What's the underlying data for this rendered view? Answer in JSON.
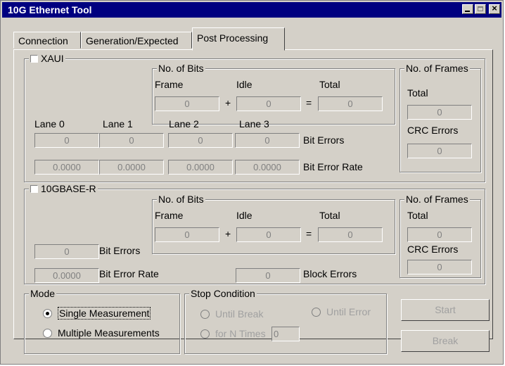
{
  "window": {
    "title": "10G Ethernet Tool"
  },
  "tabs": [
    {
      "label": "Connection"
    },
    {
      "label": "Generation/Expected"
    },
    {
      "label": "Post Processing"
    }
  ],
  "xaui": {
    "label": "XAUI",
    "checked": false,
    "bits_group": {
      "title": "No. of Bits",
      "frame_label": "Frame",
      "idle_label": "Idle",
      "total_label": "Total",
      "frame": "0",
      "idle": "0",
      "total": "0",
      "plus": "+",
      "equals": "="
    },
    "frames_group": {
      "title": "No. of Frames",
      "total_label": "Total",
      "total": "0",
      "crc_label": "CRC Errors",
      "crc": "0"
    },
    "lanes": [
      {
        "label": "Lane 0",
        "bit_errors": "0",
        "bit_error_rate": "0.0000"
      },
      {
        "label": "Lane 1",
        "bit_errors": "0",
        "bit_error_rate": "0.0000"
      },
      {
        "label": "Lane 2",
        "bit_errors": "0",
        "bit_error_rate": "0.0000"
      },
      {
        "label": "Lane 3",
        "bit_errors": "0",
        "bit_error_rate": "0.0000"
      }
    ],
    "bit_errors_label": "Bit Errors",
    "bit_error_rate_label": "Bit Error Rate"
  },
  "base_r": {
    "label": "10GBASE-R",
    "checked": false,
    "bits_group": {
      "title": "No. of Bits",
      "frame_label": "Frame",
      "idle_label": "Idle",
      "total_label": "Total",
      "frame": "0",
      "idle": "0",
      "total": "0",
      "plus": "+",
      "equals": "="
    },
    "frames_group": {
      "title": "No. of Frames",
      "total_label": "Total",
      "total": "0",
      "crc_label": "CRC Errors",
      "crc": "0"
    },
    "bit_errors": "0",
    "bit_errors_label": "Bit Errors",
    "bit_error_rate": "0.0000",
    "bit_error_rate_label": "Bit Error Rate",
    "block_errors": "0",
    "block_errors_label": "Block Errors"
  },
  "mode": {
    "title": "Mode",
    "options": [
      {
        "label": "Single Measurement",
        "selected": true
      },
      {
        "label": "Multiple Measurements",
        "selected": false
      }
    ]
  },
  "stop_condition": {
    "title": "Stop Condition",
    "until_break": "Until Break",
    "until_error": "Until Error",
    "for_n_times": "for N Times",
    "n_value": "0"
  },
  "buttons": {
    "start": "Start",
    "break": "Break"
  }
}
